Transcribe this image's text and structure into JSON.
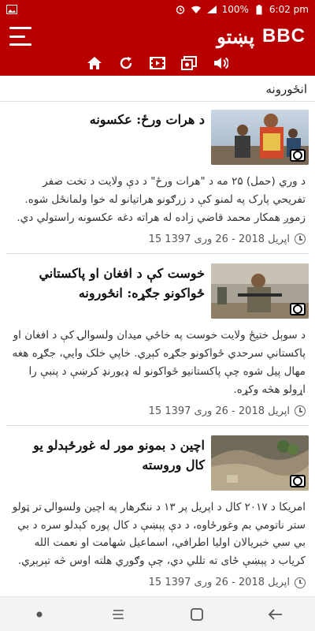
{
  "status": {
    "battery": "100%",
    "time": "6:02 pm"
  },
  "header": {
    "title": "پښتو",
    "logo": "BBC",
    "accent": "#b80000"
  },
  "toolbar": {
    "icons": [
      "home-icon",
      "refresh-icon",
      "video-icon",
      "photo-gallery-icon",
      "audio-icon"
    ]
  },
  "section": {
    "title": "انځورونه"
  },
  "articles": [
    {
      "headline": "د هرات ورځ: عکسونه",
      "summary": "د وري (حمل) ۲۵ مه د \"هرات ورځ\" د دې ولایت د تخت صفر تفريحي پارک په لمنو کې د زرګونو هراتيانو له خوا ولمانځل شوه. زموږ همکار محمد قاضي زاده له هراته دغه عکسونه راستولي دي.",
      "date": "15 اپریل 2018 - 26 وری 1397"
    },
    {
      "headline": "خوست کې د افغان او پاکستاني ځواکونو جګړه: انځورونه",
      "summary": "د سوېل ختیځ ولایت خوست په خاځي میدان ولسوالۍ کې د افغان او پاکستاني سرحدي ځواکونو جګړه کېږي. خاپي خلک وایي، جګړه هغه مهال پیل شوه چې پاکستانيو ځواکونو له ډیورنډ کرښې د پنبې را اړولو هڅه وکړه.",
      "date": "15 اپریل 2018 - 26 وری 1397"
    },
    {
      "headline": "اچین د بمونو مور له غورځېدلو یو کال وروسته",
      "summary": "امریکا د ۲۰۱۷ کال د اپریل پر ۱۳ د ننګرهار په اچین ولسوالۍ تر ټولو ستر ناتومي بم وغورځاوه، د دې پېښې د کال پوره کېدلو سره د بي بي سي خبریالان اولیا اطرافي، اسماعیل شهامت او نعمت الله کریاب د پېښې ځای ته تللي دي، چې وګوري هلته اوس څه تېرېږي.",
      "date": "15 اپریل 2018 - 26 وری 1397"
    }
  ]
}
